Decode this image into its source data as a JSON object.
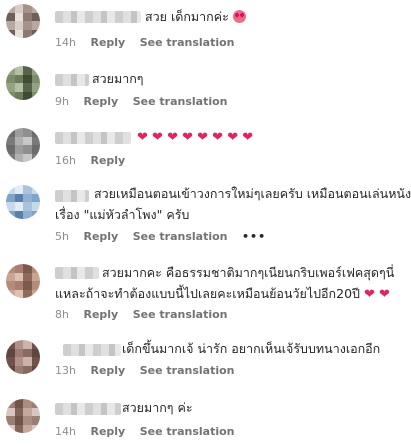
{
  "comments": [
    {
      "lines": [
        "สวย เด็กมากค่ะ"
      ],
      "emoji": "smiling-face-with-heart-eyes",
      "time": "14h",
      "reply": "Reply",
      "see_translation": "See translation",
      "colors": [
        "#b9a8a0",
        "#8c7a72",
        "#d8ccc6",
        "#6e5f58",
        "#a5928a",
        "#e8e0dc"
      ]
    },
    {
      "lines": [
        "สวยมากๆ"
      ],
      "time": "9h",
      "reply": "Reply",
      "see_translation": "See translation",
      "colors": [
        "#6b7c5a",
        "#94a37f",
        "#3f4c35",
        "#b4bfa3",
        "#7d8c6a",
        "#55644a"
      ]
    },
    {
      "lines": [
        ""
      ],
      "hearts": 8,
      "time": "16h",
      "reply": "Reply",
      "colors": [
        "#8f8f8f",
        "#b0b0b0",
        "#6c6c6c",
        "#c8c8c8",
        "#9d9d9d",
        "#7a7a7a"
      ]
    },
    {
      "lines": [
        "สวยเหมือนตอนเข้าวงการใหม่ๆเลยครับ เหมือนตอนเล่นหนัง",
        "เรื่อง \"แม่หัวลำโพง\" ครับ"
      ],
      "time": "5h",
      "reply": "Reply",
      "see_translation": "See translation",
      "more": "•••",
      "colors": [
        "#7fa3c9",
        "#a9c3dd",
        "#5a7fa8",
        "#c8d9ea",
        "#8fb0d2",
        "#e2ecf5"
      ]
    },
    {
      "lines": [
        "สวยมากคะ คือธรรมชาติมากๆเนียนกริบเพอร์เฟคสุดๆนี่",
        "แหละถ้าจะทำต้องแบบนี้ไปเลยคะเหมือนย้อนวัยไปอีก20ปี"
      ],
      "hearts": 2,
      "time": "8h",
      "reply": "Reply",
      "see_translation": "See translation",
      "colors": [
        "#a87e6e",
        "#c9a394",
        "#7d5a4c",
        "#dcc0b4",
        "#b48c7c",
        "#8f6a5b"
      ]
    },
    {
      "lines": [
        "เด็กขึ้นมากเจ้ น่ารัก อยากเห็นเจ้รับบทนางเอกอีก"
      ],
      "time": "13h",
      "reply": "Reply",
      "see_translation": "See translation",
      "colors": [
        "#8a6a60",
        "#b0918a",
        "#5f463e",
        "#cbb3ac",
        "#9b7b72",
        "#705249"
      ]
    },
    {
      "lines": [
        "สวยมากๆ ค่ะ"
      ],
      "time": "14h",
      "reply": "Reply",
      "see_translation": "See translation",
      "colors": [
        "#9b7e74",
        "#c2a89f",
        "#6f5549",
        "#d8c7c0",
        "#a98d83",
        "#826559"
      ]
    }
  ]
}
